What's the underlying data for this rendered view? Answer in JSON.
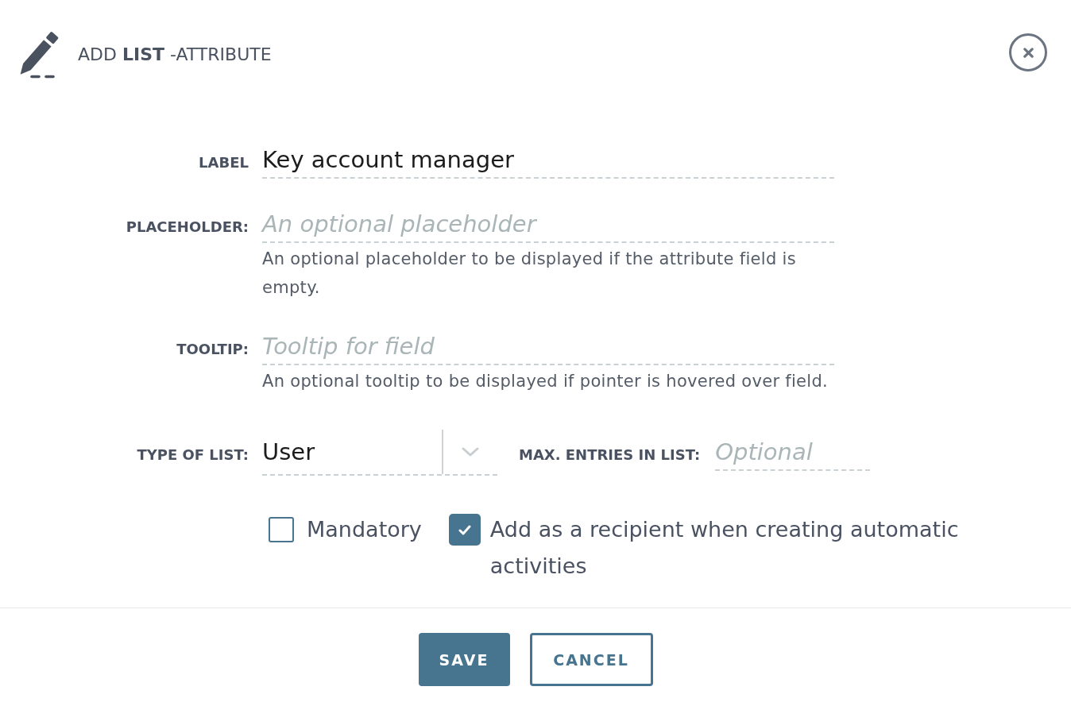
{
  "header": {
    "title": "ADD **LIST** -ATTRIBUTE"
  },
  "fields": [
    {
      "label": "LABEL",
      "value": "Key account manager"
    },
    {
      "label": "PLACEHOLDER:",
      "placeholder": "An optional placeholder",
      "help": "An optional placeholder to be displayed if the attribute field is empty."
    },
    {
      "label": "TOOLTIP:",
      "placeholder": "Tooltip for field",
      "help": "An optional tooltip to be displayed if pointer is hovered over field."
    }
  ],
  "list_settings": {
    "type_of_list": {
      "label": "TYPE OF LIST:",
      "value": "User"
    },
    "max_entries": {
      "label": "MAX. ENTRIES IN LIST:",
      "placeholder": "Optional"
    }
  },
  "options": [
    {
      "label": "Mandatory",
      "checked": false
    },
    {
      "label": "Add as a recipient when creating automatic activities",
      "checked": true
    }
  ],
  "buttons": [
    {
      "label": "SAVE",
      "kind": "primary"
    },
    {
      "label": "CANCEL",
      "kind": "secondary"
    }
  ]
}
